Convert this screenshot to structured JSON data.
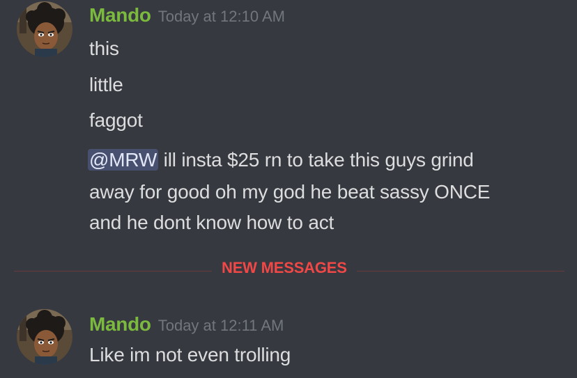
{
  "messages": [
    {
      "author": "Mando",
      "timestamp": "Today at 12:10 AM",
      "lines": [
        "this",
        "little",
        "faggot"
      ],
      "mention": "@MRW",
      "mention_text": " ill insta $25 rn to take this guys grind",
      "wrap_lines": [
        "away for good oh my god he beat sassy ONCE",
        "and he dont know how to act"
      ]
    },
    {
      "author": "Mando",
      "timestamp": "Today at 12:11 AM",
      "lines": [
        "Like im not even trolling"
      ]
    }
  ],
  "divider": {
    "label": "NEW MESSAGES"
  },
  "colors": {
    "background": "#36393f",
    "username": "#7cba3f",
    "timestamp": "#72767d",
    "message_text": "#dcddde",
    "new_messages": "#f04747",
    "mention_bg": "#414675"
  }
}
